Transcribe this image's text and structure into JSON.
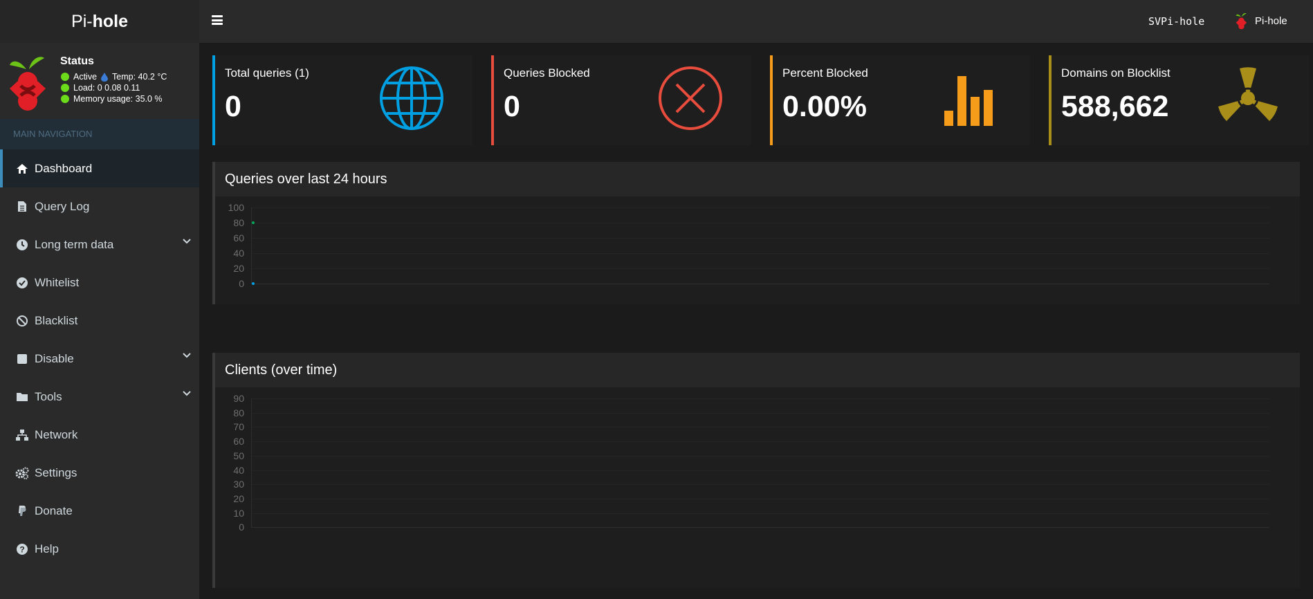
{
  "brand": {
    "prefix": "Pi-",
    "name": "hole"
  },
  "status": {
    "title": "Status",
    "active": "Active",
    "temp": "Temp: 40.2 °C",
    "load": "Load:  0  0.08  0.11",
    "memory": "Memory usage:  35.0 %"
  },
  "nav": {
    "header": "MAIN NAVIGATION",
    "items": [
      {
        "label": "Dashboard",
        "icon": "home-icon"
      },
      {
        "label": "Query Log",
        "icon": "file-icon"
      },
      {
        "label": "Long term data",
        "icon": "clock-icon"
      },
      {
        "label": "Whitelist",
        "icon": "check-circle-icon"
      },
      {
        "label": "Blacklist",
        "icon": "ban-icon"
      },
      {
        "label": "Disable",
        "icon": "square-icon"
      },
      {
        "label": "Tools",
        "icon": "folder-icon"
      },
      {
        "label": "Network",
        "icon": "network-icon"
      },
      {
        "label": "Settings",
        "icon": "gears-icon"
      },
      {
        "label": "Donate",
        "icon": "paypal-icon"
      },
      {
        "label": "Help",
        "icon": "question-circle-icon"
      }
    ]
  },
  "topbar": {
    "hostname": "SVPi-hole",
    "user": "Pi-hole"
  },
  "stats": [
    {
      "label": "Total queries (1)",
      "value": "0",
      "color": "#00a0e3",
      "icon": "globe-icon"
    },
    {
      "label": "Queries Blocked",
      "value": "0",
      "color": "#e84c3d",
      "icon": "x-circle-icon"
    },
    {
      "label": "Percent Blocked",
      "value": "0.00%",
      "color": "#f59c1a",
      "icon": "bar-chart-icon"
    },
    {
      "label": "Domains on Blocklist",
      "value": "588,662",
      "color": "#a98f1a",
      "icon": "radiation-icon"
    }
  ],
  "panels": {
    "queries": {
      "title": "Queries over last 24 hours"
    },
    "clients": {
      "title": "Clients (over time)"
    }
  },
  "chart_data": [
    {
      "type": "line",
      "title": "Queries over last 24 hours",
      "yticks": [
        "100",
        "80",
        "60",
        "40",
        "20",
        "0"
      ],
      "ylim": [
        0,
        100
      ],
      "series": [
        {
          "values": [
            0
          ],
          "color": "#00a0e3"
        },
        {
          "values": [
            80
          ],
          "color": "#00a65a"
        }
      ]
    },
    {
      "type": "line",
      "title": "Clients (over time)",
      "yticks": [
        "90",
        "80",
        "70",
        "60",
        "50",
        "40",
        "30",
        "20",
        "10",
        "0"
      ],
      "ylim": [
        0,
        90
      ],
      "series": []
    }
  ]
}
